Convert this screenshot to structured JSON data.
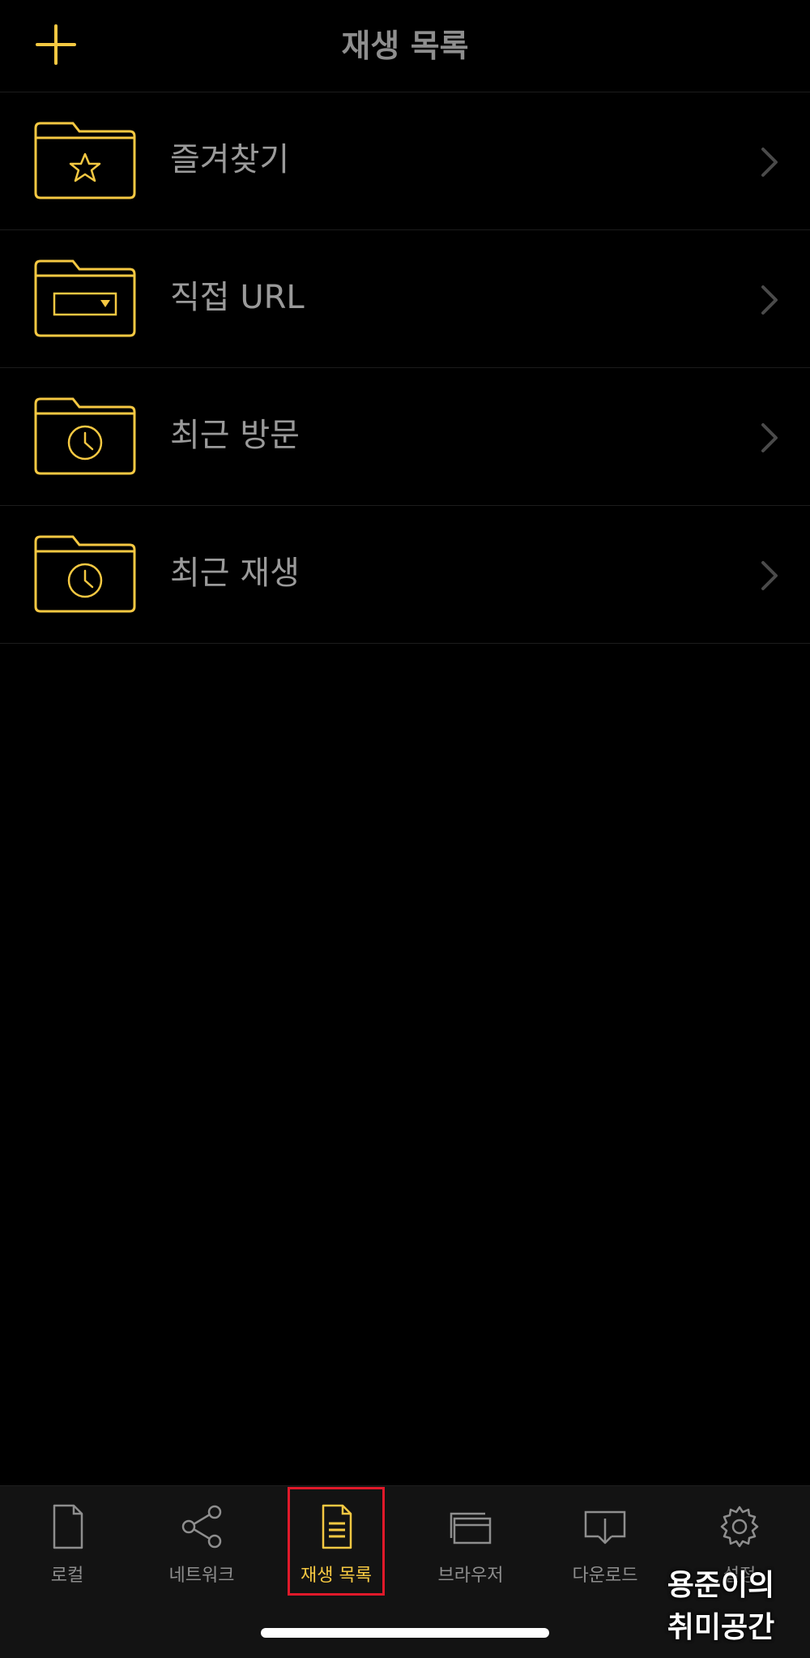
{
  "header": {
    "title": "재생 목록",
    "add_icon": "plus-icon"
  },
  "colors": {
    "accent": "#f5c842",
    "text": "#9a9a9a",
    "highlight": "#e0192a"
  },
  "list": [
    {
      "label": "즐겨찾기",
      "icon": "folder-star-icon"
    },
    {
      "label": "직접 URL",
      "icon": "folder-url-icon"
    },
    {
      "label": "최근 방문",
      "icon": "folder-clock-icon"
    },
    {
      "label": "최근 재생",
      "icon": "folder-clock-icon"
    }
  ],
  "tabs": [
    {
      "label": "로컬",
      "icon": "document-icon"
    },
    {
      "label": "네트워크",
      "icon": "share-icon"
    },
    {
      "label": "재생 목록",
      "icon": "playlist-icon",
      "active": true
    },
    {
      "label": "브라우저",
      "icon": "browser-windows-icon"
    },
    {
      "label": "다운로드",
      "icon": "download-icon"
    },
    {
      "label": "설정",
      "icon": "gear-icon"
    }
  ],
  "watermark": {
    "line1": "용준이의",
    "line2": "취미공간"
  }
}
